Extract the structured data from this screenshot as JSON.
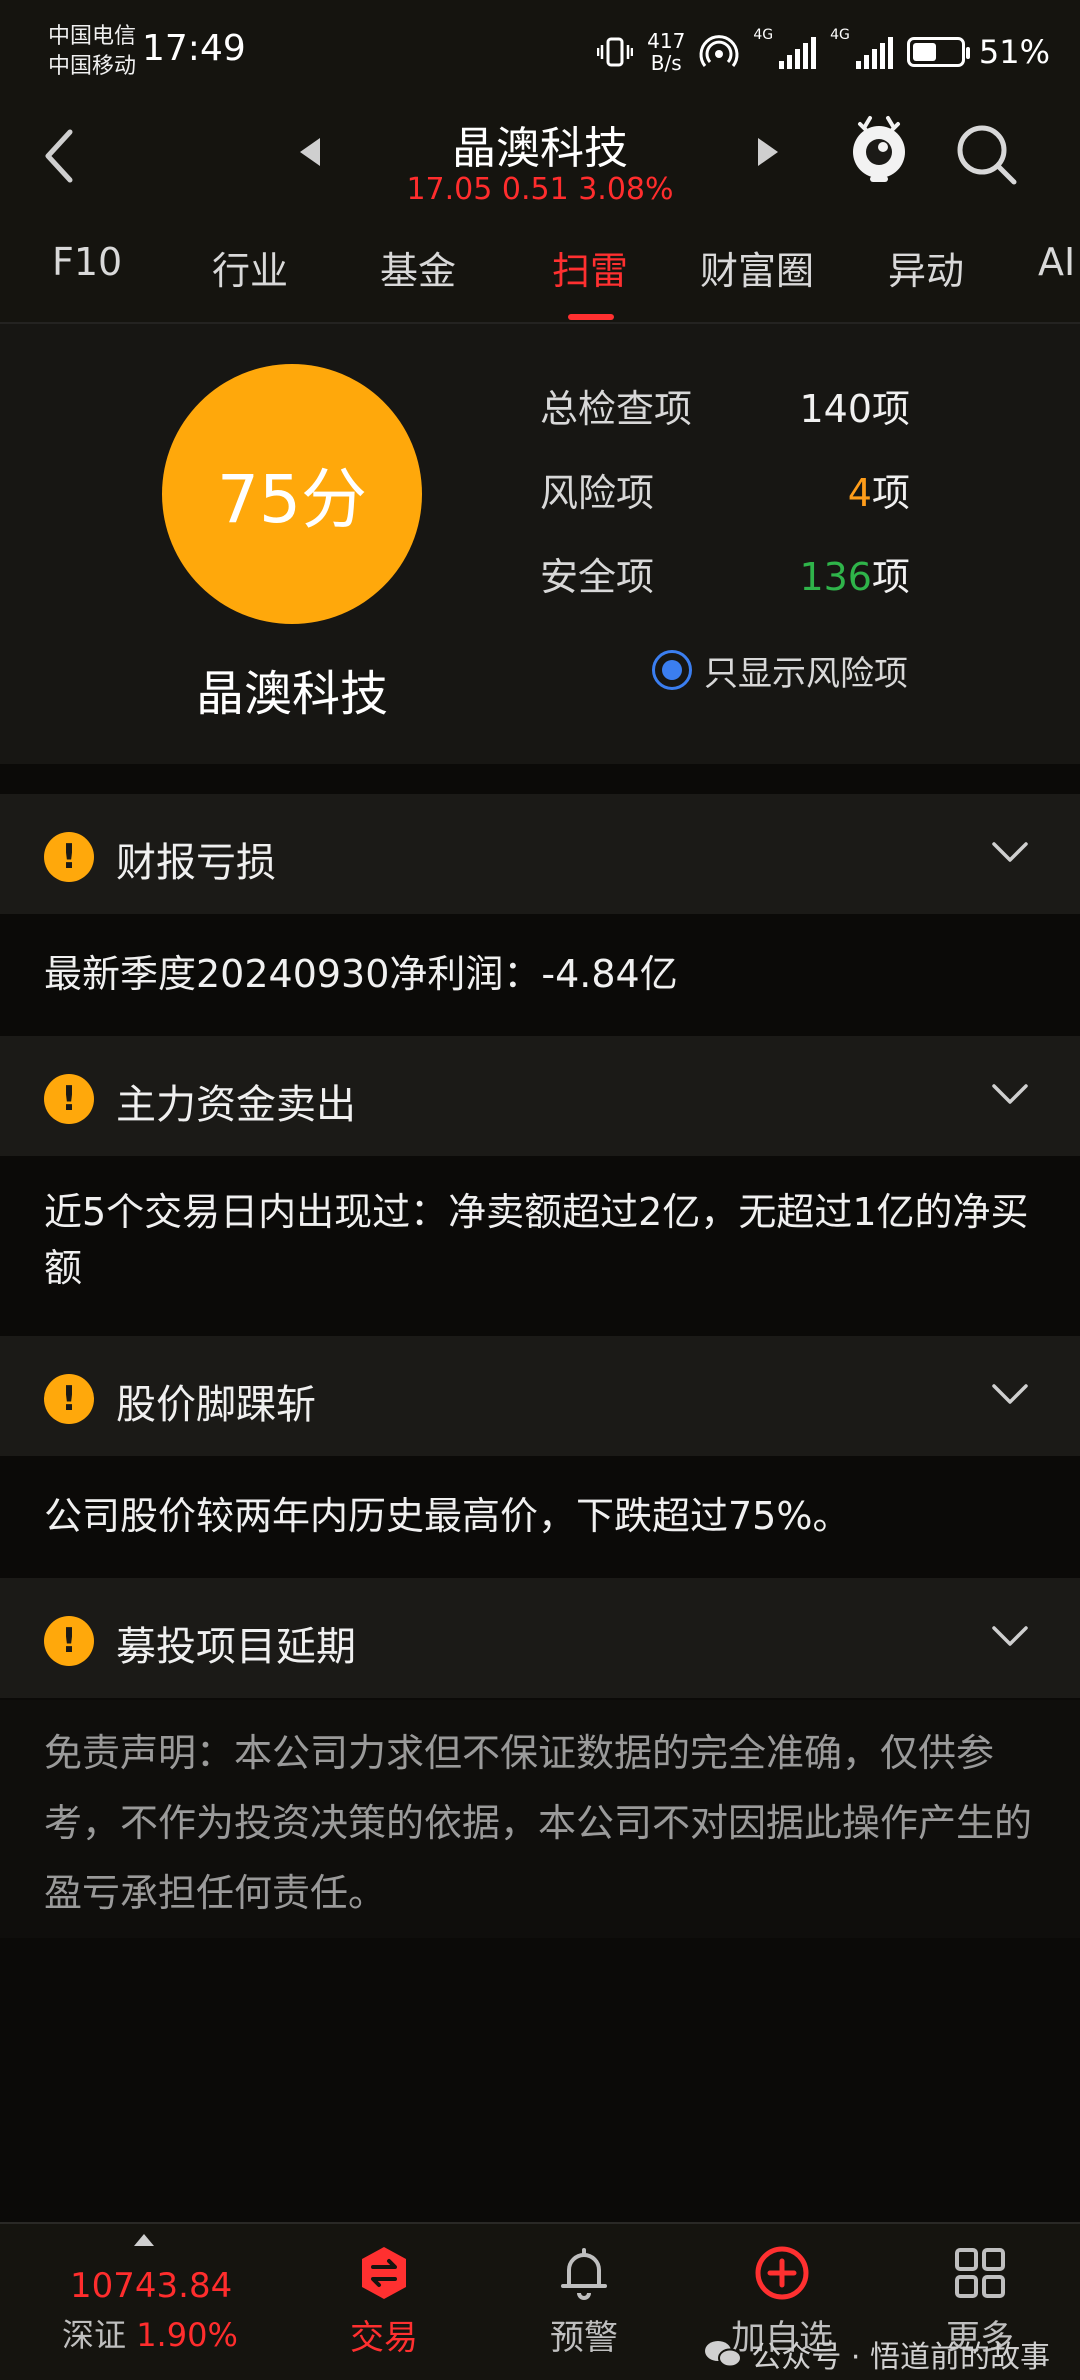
{
  "status_bar": {
    "carrier1": "中国电信",
    "carrier2": "中国移动",
    "time": "17:49",
    "speed_value": "417",
    "speed_unit": "B/s",
    "net1": "4G",
    "net2": "4G",
    "battery": "51%",
    "battery_level": 0.51
  },
  "header": {
    "title": "晶澳科技",
    "quote": "17.05 0.51 3.08%"
  },
  "tabs": [
    {
      "label": "F10"
    },
    {
      "label": "行业"
    },
    {
      "label": "基金"
    },
    {
      "label": "扫雷",
      "active": true
    },
    {
      "label": "财富圈"
    },
    {
      "label": "异动"
    },
    {
      "label": "AI"
    }
  ],
  "score": {
    "value": "75分",
    "company": "晶澳科技",
    "total_label": "总检查项",
    "total_value": "140项",
    "risk_label": "风险项",
    "risk_value": "4项",
    "safe_label": "安全项",
    "safe_value": "136项",
    "filter_label": "只显示风险项",
    "color_score": "#ffa80b",
    "color_risk": "#ff9d1a",
    "color_safe": "#2fb44a"
  },
  "risks": [
    {
      "title": "财报亏损",
      "detail": "最新季度20240930净利润：-4.84亿"
    },
    {
      "title": "主力资金卖出",
      "detail": "近5个交易日内出现过：净卖额超过2亿，无超过1亿的净买额"
    },
    {
      "title": "股价脚踝斩",
      "detail": "公司股价较两年内历史最高价，下跌超过75%。"
    },
    {
      "title": "募投项目延期",
      "detail": ""
    }
  ],
  "disclaimer": "免责声明：本公司力求但不保证数据的完全准确，仅供参考，不作为投资决策的依据，本公司不对因据此操作产生的盈亏承担任何责任。",
  "bottom_nav": {
    "index_value": "10743.84",
    "index_name": "深证",
    "index_pct": "1.90%",
    "items": [
      {
        "label": "交易",
        "icon": "trade-icon"
      },
      {
        "label": "预警",
        "icon": "bell-icon"
      },
      {
        "label": "加自选",
        "icon": "add-circle-icon"
      },
      {
        "label": "更多",
        "icon": "grid-icon"
      }
    ]
  },
  "watermark": "公众号 · 悟道前的故事"
}
